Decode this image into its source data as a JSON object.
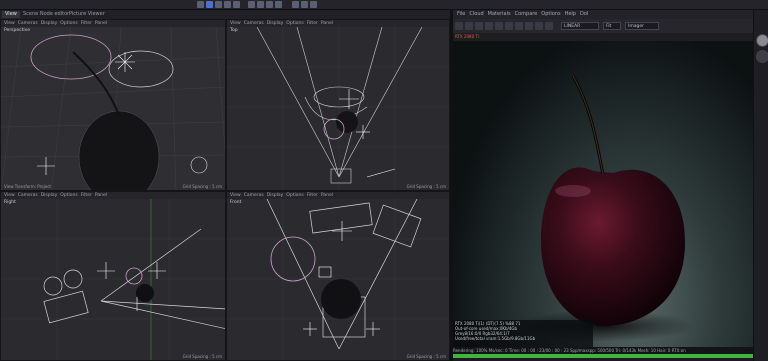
{
  "toolbar": {
    "icon_count": 12
  },
  "tabs": {
    "items": [
      "View",
      "Scene Node editor",
      "Picture Viewer"
    ]
  },
  "viewports": {
    "top_left": {
      "menu": [
        "View",
        "Cameras",
        "Display",
        "Options",
        "Filter",
        "Panel"
      ],
      "label": "Perspective",
      "footer_left": "View Transform: Project",
      "footer_right": "Grid Spacing : 5 cm"
    },
    "top_right": {
      "menu": [
        "View",
        "Cameras",
        "Display",
        "Options",
        "Filter",
        "Panel"
      ],
      "label": "Top",
      "footer_right": "Grid Spacing : 5 cm"
    },
    "bottom_left": {
      "menu": [
        "View",
        "Cameras",
        "Display",
        "Options",
        "Filter",
        "Panel"
      ],
      "label": "Right",
      "footer_right": "Grid Spacing : 5 cm"
    },
    "bottom_right": {
      "menu": [
        "View",
        "Cameras",
        "Display",
        "Options",
        "Filter",
        "Panel"
      ],
      "label": "Front",
      "footer_right": "Grid Spacing : 5 cm"
    }
  },
  "render_view": {
    "menu": [
      "File",
      "Cloud",
      "Materials",
      "Compare",
      "Options",
      "Help",
      "Dol"
    ],
    "colorspace": "LINEAR",
    "zoom": "Fit",
    "mode": "Imager",
    "strip_text": "RTX 2080 Ti",
    "stats": [
      "RTX 2080 Ti(1)  (DT)(7.5)   %88   71",
      "Out-of-core used/max:0Kb/4Gb",
      "Grey8/16:0/0      Rgb32/64:1/7",
      "Used/free/total vram:1.5Gb/9.8Gb/11Gb"
    ],
    "status": "Rendering: 100%  Ms/sec: 0   Time: 00 : 00 : 23/00 : 00 : 23   Spp/maxspp: 500/500   Tri: 0/143k   Mesh: 10   Hair: 0   RTX:on",
    "progress": 1.0
  },
  "colors": {
    "accent": "#4a6fd6",
    "progress": "#3fb43f",
    "error": "#e06040"
  }
}
